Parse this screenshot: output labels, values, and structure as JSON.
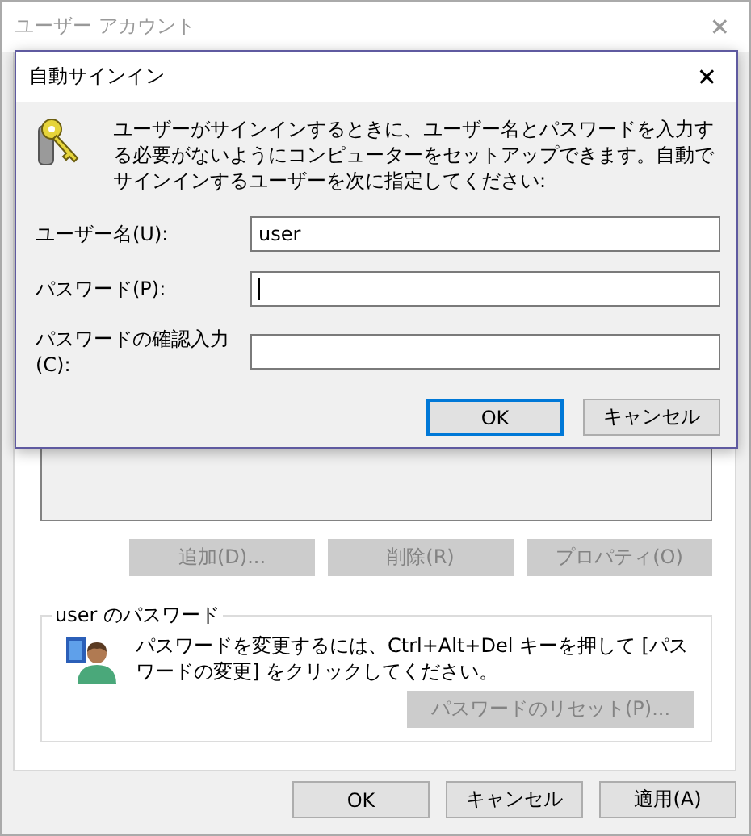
{
  "window": {
    "title": "ユーザー アカウント",
    "close": "✕"
  },
  "list_buttons": [
    {
      "label": "追加(D)...",
      "disabled": true
    },
    {
      "label": "削除(R)",
      "disabled": true
    },
    {
      "label": "プロパティ(O)",
      "disabled": true
    }
  ],
  "password_group": {
    "title": "user のパスワード",
    "text": "パスワードを変更するには、Ctrl+Alt+Del キーを押して [パスワードの変更] をクリックしてください。",
    "reset_button": {
      "label": "パスワードのリセット(P)...",
      "disabled": true
    }
  },
  "buttons": [
    {
      "label": "OK",
      "disabled": false
    },
    {
      "label": "キャンセル",
      "disabled": false
    },
    {
      "label": "適用(A)",
      "disabled": false
    }
  ],
  "dialog": {
    "title": "自動サインイン",
    "close": "✕",
    "message": "ユーザーがサインインするときに、ユーザー名とパスワードを入力する必要がないようにコンピューターをセットアップできます。自動でサインインするユーザーを次に指定してください:",
    "fields": [
      {
        "label": "ユーザー名(U):",
        "value": "user",
        "focused": false
      },
      {
        "label": "パスワード(P):",
        "focused": true
      },
      {
        "label": "パスワードの確認入力(C):",
        "focused": false
      }
    ],
    "buttons": [
      {
        "label": "OK",
        "default": true
      },
      {
        "label": "キャンセル",
        "default": false
      }
    ]
  }
}
